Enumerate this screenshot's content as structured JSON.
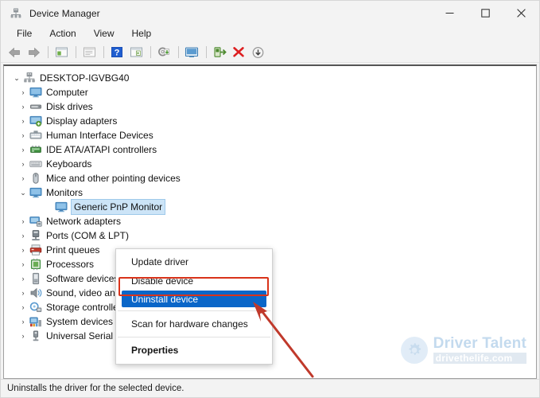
{
  "window": {
    "title": "Device Manager",
    "app_icon": "device-manager-icon",
    "controls": {
      "minimize": "—",
      "maximize": "☐",
      "close": "✕"
    }
  },
  "menubar": {
    "items": [
      {
        "label": "File"
      },
      {
        "label": "Action"
      },
      {
        "label": "View"
      },
      {
        "label": "Help"
      }
    ]
  },
  "toolbar": {
    "buttons": [
      {
        "name": "back-icon"
      },
      {
        "name": "forward-icon"
      },
      {
        "name": "separator"
      },
      {
        "name": "show-hidden-devices-icon"
      },
      {
        "name": "separator"
      },
      {
        "name": "properties-icon"
      },
      {
        "name": "separator"
      },
      {
        "name": "help-icon"
      },
      {
        "name": "scan-console-icon"
      },
      {
        "name": "separator"
      },
      {
        "name": "update-driver-icon"
      },
      {
        "name": "separator"
      },
      {
        "name": "scan-hardware-changes-icon"
      },
      {
        "name": "separator"
      },
      {
        "name": "enable-device-icon"
      },
      {
        "name": "uninstall-device-icon"
      },
      {
        "name": "download-icon"
      }
    ]
  },
  "tree": {
    "root": {
      "label": "DESKTOP-IGVBG40",
      "icon": "computer-root-icon",
      "expanded": true,
      "chevron": "⌄"
    },
    "nodes": [
      {
        "label": "Computer",
        "icon": "computer-icon",
        "chevron": "›",
        "expanded": false,
        "level": 1
      },
      {
        "label": "Disk drives",
        "icon": "disk-drive-icon",
        "chevron": "›",
        "expanded": false,
        "level": 1
      },
      {
        "label": "Display adapters",
        "icon": "display-adapter-icon",
        "chevron": "›",
        "expanded": false,
        "level": 1
      },
      {
        "label": "Human Interface Devices",
        "icon": "hid-icon",
        "chevron": "›",
        "expanded": false,
        "level": 1
      },
      {
        "label": "IDE ATA/ATAPI controllers",
        "icon": "ide-controller-icon",
        "chevron": "›",
        "expanded": false,
        "level": 1
      },
      {
        "label": "Keyboards",
        "icon": "keyboard-icon",
        "chevron": "›",
        "expanded": false,
        "level": 1
      },
      {
        "label": "Mice and other pointing devices",
        "icon": "mouse-icon",
        "chevron": "›",
        "expanded": false,
        "level": 1
      },
      {
        "label": "Monitors",
        "icon": "monitor-icon",
        "chevron": "⌄",
        "expanded": true,
        "level": 1
      },
      {
        "label": "Generic PnP Monitor",
        "icon": "monitor-icon",
        "chevron": "",
        "expanded": false,
        "level": 2,
        "selected": true
      },
      {
        "label": "Network adapters",
        "icon": "network-adapter-icon",
        "chevron": "›",
        "expanded": false,
        "level": 1
      },
      {
        "label": "Ports (COM & LPT)",
        "icon": "port-icon",
        "chevron": "›",
        "expanded": false,
        "level": 1
      },
      {
        "label": "Print queues",
        "icon": "printer-icon",
        "chevron": "›",
        "expanded": false,
        "level": 1
      },
      {
        "label": "Processors",
        "icon": "processor-icon",
        "chevron": "›",
        "expanded": false,
        "level": 1
      },
      {
        "label": "Software devices",
        "icon": "software-device-icon",
        "chevron": "›",
        "expanded": false,
        "level": 1
      },
      {
        "label": "Sound, video and game controllers",
        "icon": "sound-icon",
        "chevron": "›",
        "expanded": false,
        "level": 1
      },
      {
        "label": "Storage controllers",
        "icon": "storage-controller-icon",
        "chevron": "›",
        "expanded": false,
        "level": 1
      },
      {
        "label": "System devices",
        "icon": "system-device-icon",
        "chevron": "›",
        "expanded": false,
        "level": 1
      },
      {
        "label": "Universal Serial Bus controllers",
        "icon": "usb-controller-icon",
        "chevron": "›",
        "expanded": false,
        "level": 1
      }
    ]
  },
  "context_menu": {
    "items": [
      {
        "label": "Update driver",
        "highlighted": false,
        "bold": false
      },
      {
        "label": "Disable device",
        "highlighted": false,
        "bold": false
      },
      {
        "label": "Uninstall device",
        "highlighted": true,
        "bold": false
      },
      {
        "label": "Scan for hardware changes",
        "highlighted": false,
        "bold": false
      },
      {
        "label": "Properties",
        "highlighted": false,
        "bold": true
      }
    ]
  },
  "annotation": {
    "color": "#d9331a",
    "target": "Uninstall device"
  },
  "watermark": {
    "title": "Driver Talent",
    "subtitle": "drivethelife.com"
  },
  "statusbar": {
    "text": "Uninstalls the driver for the selected device."
  },
  "colors": {
    "highlight_blue": "#0a66c8",
    "selection_blue": "#cce4f7",
    "annotation_red": "#d9331a",
    "window_bg": "#f3f3f3"
  }
}
